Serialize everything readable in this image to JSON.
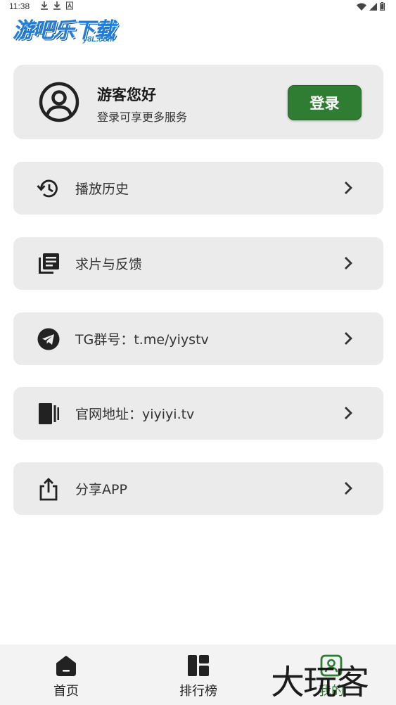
{
  "status_bar": {
    "time": "11:38",
    "icons_left": [
      "download-icon",
      "download-icon",
      "a-icon"
    ],
    "icons_right": [
      "wifi-icon",
      "signal-icon",
      "battery-icon"
    ]
  },
  "logo": {
    "main_text": "游吧乐下载",
    "sub_text": "y8L.com"
  },
  "user_card": {
    "title": "游客您好",
    "subtitle": "登录可享更多服务",
    "login_label": "登录",
    "accent_color": "#2e7d32"
  },
  "menu": [
    {
      "label": "播放历史",
      "icon": "history-icon"
    },
    {
      "label": "求片与反馈",
      "icon": "library-icon"
    },
    {
      "label": "TG群号：t.me/yiystv",
      "icon": "telegram-icon"
    },
    {
      "label": "官网地址：yiyiyi.tv",
      "icon": "website-icon"
    },
    {
      "label": "分享APP",
      "icon": "share-icon"
    }
  ],
  "bottom_nav": [
    {
      "label": "首页",
      "icon": "home-icon",
      "active": false
    },
    {
      "label": "排行榜",
      "icon": "ranking-icon",
      "active": false
    },
    {
      "label": "我的",
      "icon": "user-icon",
      "active": true
    }
  ],
  "watermark": "大玩客"
}
